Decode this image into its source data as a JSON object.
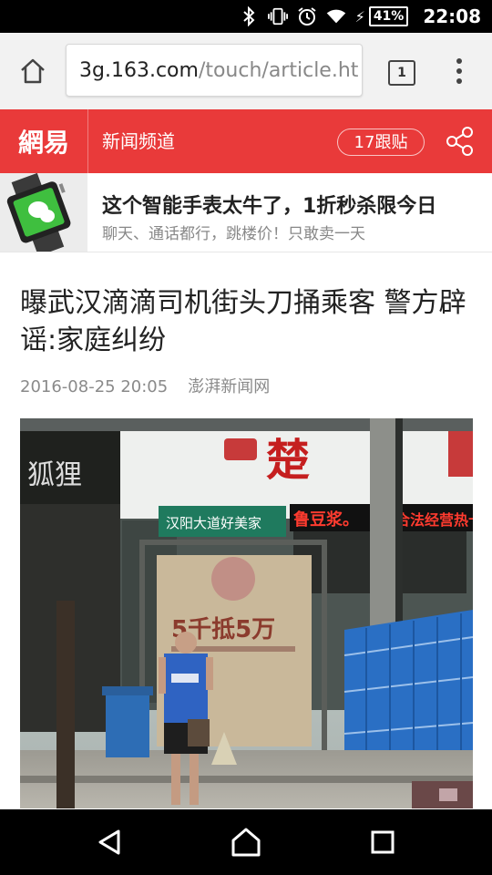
{
  "status_bar": {
    "battery": "41%",
    "time": "22:08",
    "icons": [
      "bluetooth-icon",
      "vibrate-icon",
      "alarm-icon",
      "wifi-icon",
      "charging-icon"
    ]
  },
  "browser": {
    "url_host": "3g.163.com",
    "url_path": "/touch/article.ht",
    "tab_count": "1"
  },
  "site": {
    "logo": "網易",
    "channel": "新闻频道",
    "follow_label": "17跟贴",
    "brand_color": "#e93a3a"
  },
  "ad": {
    "title": "这个智能手表太牛了，1折秒杀限今日",
    "subtitle": "聊天、通话都行，跳楼价！只敢卖一天"
  },
  "article": {
    "title": "曝武汉滴滴司机街头刀捅乘客 警方辟谣:家庭纠纷",
    "date": "2016-08-25 20:05",
    "source": "澎湃新闻网"
  },
  "photo_signs": {
    "shop_left": "狐狸",
    "shop_main": "楚",
    "street_sign": "汉阳大道好美家",
    "led_text": "鲁豆浆。",
    "led_text_2": "合法经营热卡",
    "poster_text": "5千抵5万"
  }
}
